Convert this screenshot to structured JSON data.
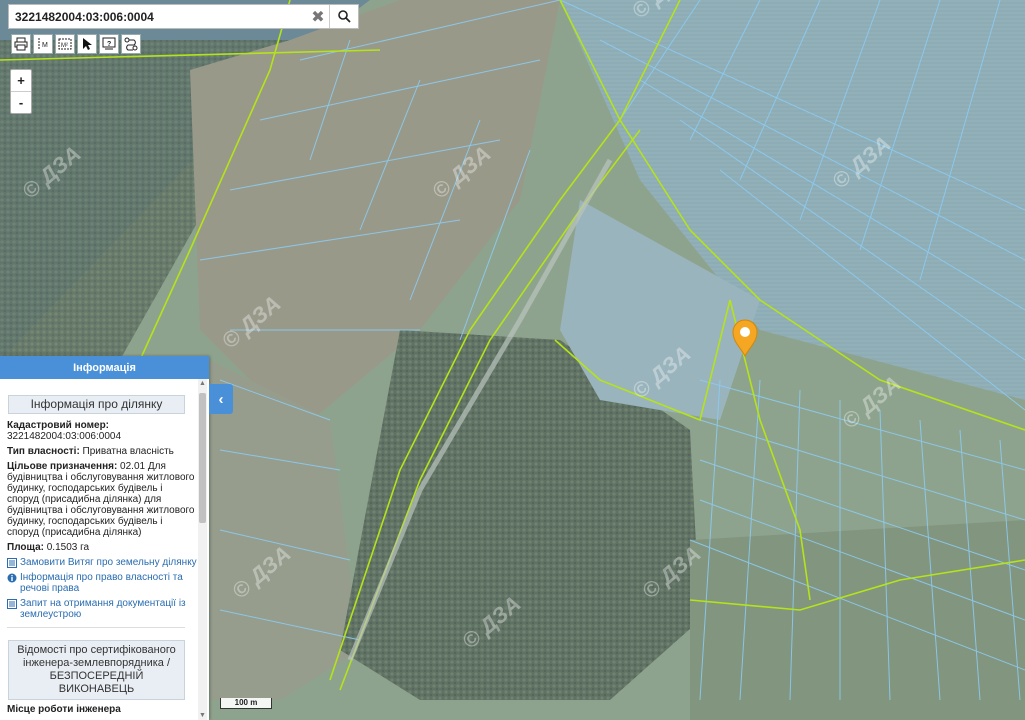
{
  "search": {
    "value": "3221482004:03:006:0004",
    "clear_glyph": "✖"
  },
  "toolbar": {
    "tools": [
      "print-icon",
      "measure-length-icon",
      "measure-area-icon",
      "pointer-icon",
      "identify-icon",
      "route-icon"
    ],
    "measure_length_label": "M",
    "measure_area_label": "M²"
  },
  "zoom": {
    "in": "+",
    "out": "-"
  },
  "map": {
    "watermark": "© ДЗА",
    "marker_color": "#f5a623",
    "parcel_color": "#8ccbf2",
    "road_color": "#b5e31a"
  },
  "panel": {
    "title": "Інформація",
    "section_title": "Інформація про ділянку",
    "cadastral_label": "Кадастровий номер:",
    "cadastral_value": "3221482004:03:006:0004",
    "ownership_label": "Тип власності:",
    "ownership_value": " Приватна власність",
    "purpose_label": "Цільове призначення:",
    "purpose_value": " 02.01 Для будівництва і обслуговування житлового будинку, господарських будівель і споруд (присадибна ділянка) для будівництва і обслуговування житлового будинку, господарських будівель і споруд (присадибна ділянка)",
    "area_label": "Площа:",
    "area_value": " 0.1503 га",
    "links": [
      "Замовити Витяг про земельну ділянку",
      "Інформація про право власності та речові права",
      "Запит на отримання документації із землеустрою"
    ],
    "engineer_title": "Відомості про сертифікованого інженера-землевпорядника / БЕЗПОСЕРЕДНІЙ ВИКОНАВЕЦЬ",
    "cut_text": "Місце роботи інженера"
  },
  "collapse_glyph": "‹",
  "scale_label": "100 m"
}
